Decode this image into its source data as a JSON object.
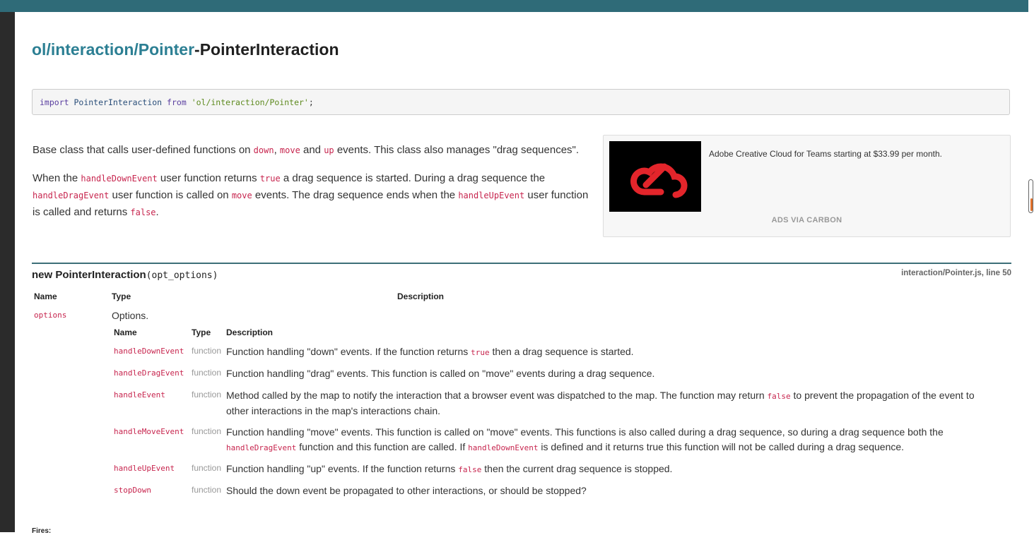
{
  "header": {
    "module": "ol/interaction/Pointer",
    "separator": "-",
    "name": "PointerInteraction"
  },
  "import_stmt": {
    "kw_import": "import",
    "ident": "PointerInteraction",
    "kw_from": "from",
    "path": "'ol/interaction/Pointer'",
    "semicolon": ";"
  },
  "description": {
    "p1": {
      "t1": "Base class that calls user-defined functions on ",
      "c1": "down",
      "t2": ", ",
      "c2": "move",
      "t3": " and ",
      "c3": "up",
      "t4": " events. This class also manages \"drag sequences\"."
    },
    "p2": {
      "t1": "When the ",
      "c1": "handleDownEvent",
      "t2": " user function returns ",
      "c2": "true",
      "t3": " a drag sequence is started. During a drag sequence the ",
      "c3": "handleDragEvent",
      "t4": " user function is called on ",
      "c4": "move",
      "t5": " events. The drag sequence ends when the ",
      "c5": "handleUpEvent",
      "t6": " user function is called and returns ",
      "c6": "false",
      "t7": "."
    }
  },
  "ad": {
    "text": "Adobe Creative Cloud for Teams starting at $33.99 per month.",
    "via": "ADS VIA CARBON",
    "logo_color": "#e3252b"
  },
  "constructor": {
    "keyword_and_name": "new PointerInteraction",
    "signature": "(opt_options)",
    "source": "interaction/Pointer.js, line 50"
  },
  "params_table": {
    "headers": {
      "name": "Name",
      "type": "Type",
      "description": "Description"
    },
    "row": {
      "name": "options",
      "description": "Options."
    }
  },
  "options_table": {
    "headers": {
      "name": "Name",
      "type": "Type",
      "description": "Description"
    },
    "rows": [
      {
        "name": "handleDownEvent",
        "type": "function",
        "d1": "Function handling \"down\" events. If the function returns ",
        "c1": "true",
        "d2": " then a drag sequence is started."
      },
      {
        "name": "handleDragEvent",
        "type": "function",
        "d1": "Function handling \"drag\" events. This function is called on \"move\" events during a drag sequence."
      },
      {
        "name": "handleEvent",
        "type": "function",
        "d1": "Method called by the map to notify the interaction that a browser event was dispatched to the map. The function may return ",
        "c1": "false",
        "d2": " to prevent the propagation of the event to other interactions in the map's interactions chain."
      },
      {
        "name": "handleMoveEvent",
        "type": "function",
        "d1": "Function handling \"move\" events. This function is called on \"move\" events. This functions is also called during a drag sequence, so during a drag sequence both the ",
        "c1": "handleDragEvent",
        "d2": " function and this function are called. If ",
        "c2": "handleDownEvent",
        "d3": " is defined and it returns true this function will not be called during a drag sequence."
      },
      {
        "name": "handleUpEvent",
        "type": "function",
        "d1": "Function handling \"up\" events. If the function returns ",
        "c1": "false",
        "d2": " then the current drag sequence is stopped."
      },
      {
        "name": "stopDown",
        "type": "function",
        "d1": "Should the down event be propagated to other interactions, or should be stopped?"
      }
    ]
  },
  "footer": {
    "flags_label": "Fires:"
  }
}
